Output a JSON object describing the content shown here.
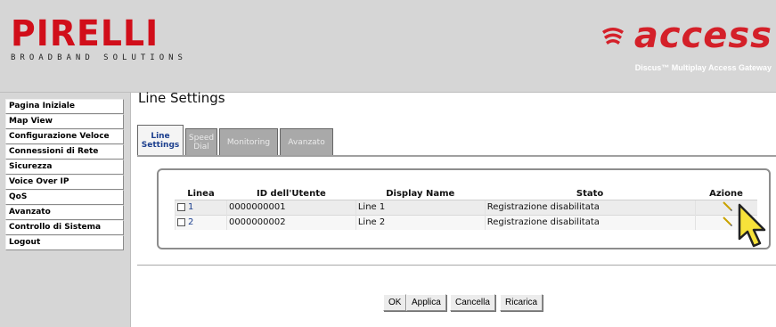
{
  "header": {
    "brand_left": "IRELLI",
    "brand_left_initial": "P",
    "brand_left_sub": "BROADBAND SOLUTIONS",
    "brand_right": "access",
    "brand_right_tagline": "Discus™ Multiplay Access Gateway"
  },
  "sidebar": {
    "items": [
      {
        "label": "Pagina Iniziale"
      },
      {
        "label": "Map View"
      },
      {
        "label": "Configurazione Veloce"
      },
      {
        "label": "Connessioni di Rete"
      },
      {
        "label": "Sicurezza"
      },
      {
        "label": "Voice Over IP"
      },
      {
        "label": "QoS"
      },
      {
        "label": "Avanzato"
      },
      {
        "label": "Controllo di Sistema"
      },
      {
        "label": "Logout"
      }
    ]
  },
  "main": {
    "title": "Line Settings",
    "tabs": [
      {
        "line1": "Line",
        "line2": "Settings",
        "active": true
      },
      {
        "line1": "Speed",
        "line2": "Dial",
        "active": false
      },
      {
        "line1": "Monitoring",
        "line2": "",
        "active": false
      },
      {
        "line1": "Avanzato",
        "line2": "",
        "active": false
      }
    ],
    "table": {
      "headers": [
        "Linea",
        "ID dell'Utente",
        "Display Name",
        "Stato",
        "Azione"
      ],
      "rows": [
        {
          "linea": "1",
          "id": "0000000001",
          "display": "Line 1",
          "stato": "Registrazione disabilitata",
          "checked": false
        },
        {
          "linea": "2",
          "id": "0000000002",
          "display": "Line 2",
          "stato": "Registrazione disabilitata",
          "checked": false
        }
      ]
    },
    "buttons": {
      "ok": "OK",
      "applica": "Applica",
      "cancella": "Cancella",
      "ricarica": "Ricarica"
    }
  },
  "icons": {
    "edit": "pencil-icon",
    "pointer": "cursor-arrow-icon"
  },
  "colors": {
    "pirelli_red": "#d10e1a",
    "access_red": "#d42029",
    "link_blue": "#1c3f8e",
    "chrome_gray": "#d6d6d6"
  }
}
